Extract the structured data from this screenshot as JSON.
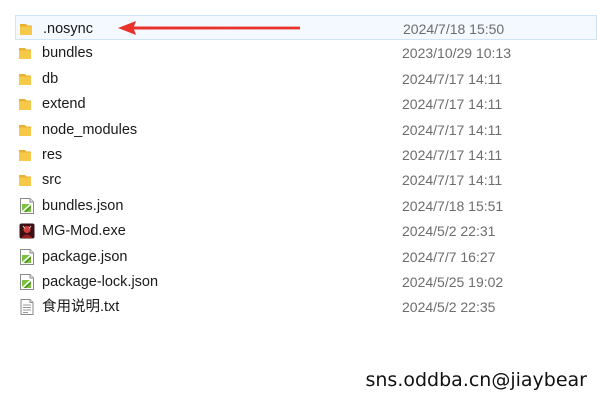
{
  "files": [
    {
      "name": ".nosync",
      "date": "2024/7/18 15:50",
      "type": "folder",
      "icon": "folder-icon",
      "selected": true
    },
    {
      "name": "bundles",
      "date": "2023/10/29 10:13",
      "type": "folder",
      "icon": "folder-icon"
    },
    {
      "name": "db",
      "date": "2024/7/17 14:11",
      "type": "folder",
      "icon": "folder-icon"
    },
    {
      "name": "extend",
      "date": "2024/7/17 14:11",
      "type": "folder",
      "icon": "folder-icon"
    },
    {
      "name": "node_modules",
      "date": "2024/7/17 14:11",
      "type": "folder",
      "icon": "folder-icon"
    },
    {
      "name": "res",
      "date": "2024/7/17 14:11",
      "type": "folder",
      "icon": "folder-icon"
    },
    {
      "name": "src",
      "date": "2024/7/17 14:11",
      "type": "folder",
      "icon": "folder-icon"
    },
    {
      "name": "bundles.json",
      "date": "2024/7/18 15:51",
      "type": "json",
      "icon": "json-file-icon"
    },
    {
      "name": "MG-Mod.exe",
      "date": "2024/5/2 22:31",
      "type": "exe",
      "icon": "exe-app-icon"
    },
    {
      "name": "package.json",
      "date": "2024/7/7 16:27",
      "type": "json",
      "icon": "json-file-icon"
    },
    {
      "name": "package-lock.json",
      "date": "2024/5/25 19:02",
      "type": "json",
      "icon": "json-file-icon"
    },
    {
      "name": "食用说明.txt",
      "date": "2024/5/2 22:35",
      "type": "txt",
      "icon": "text-file-icon"
    }
  ],
  "watermark": "sns.oddba.cn@jiaybear",
  "colors": {
    "folder": "#f7c948",
    "arrow": "#e8322b",
    "selection_border": "#cde6f7",
    "date_text": "#6d6d6d"
  }
}
